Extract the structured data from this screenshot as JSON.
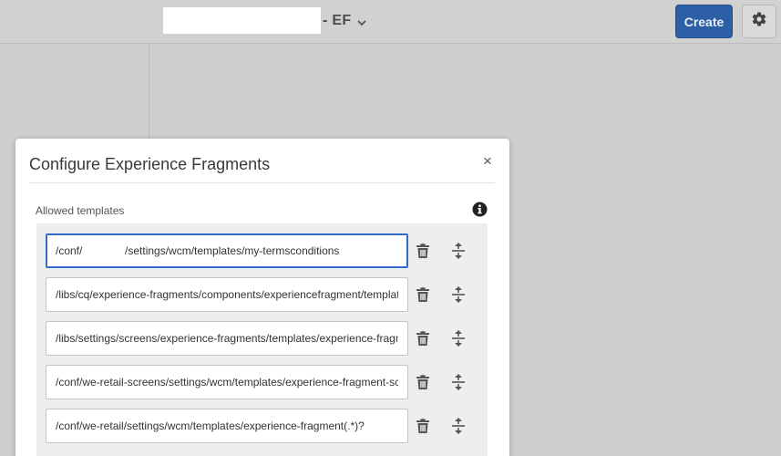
{
  "header": {
    "title_suffix": "- EF",
    "create_label": "Create",
    "icons": {
      "title_dropdown": "chevron-down-icon",
      "settings": "gear-icon"
    }
  },
  "dialog": {
    "title": "Configure Experience Fragments",
    "close_label": "×",
    "field_label": "Allowed templates",
    "info_icon": "info-icon",
    "templates": [
      "/conf/              /settings/wcm/templates/my-termsconditions",
      "/libs/cq/experience-fragments/components/experiencefragment/template",
      "/libs/settings/screens/experience-fragments/templates/experience-fragment-template",
      "/conf/we-retail-screens/settings/wcm/templates/experience-fragment-screens-template",
      "/conf/we-retail/settings/wcm/templates/experience-fragment(.*)?"
    ],
    "row_icons": {
      "delete": "trash-icon",
      "reorder": "move-handle-icon"
    }
  },
  "colors": {
    "primary": "#2d5fa7",
    "focus": "#326ec8",
    "backdrop": "#cfcfcf"
  }
}
